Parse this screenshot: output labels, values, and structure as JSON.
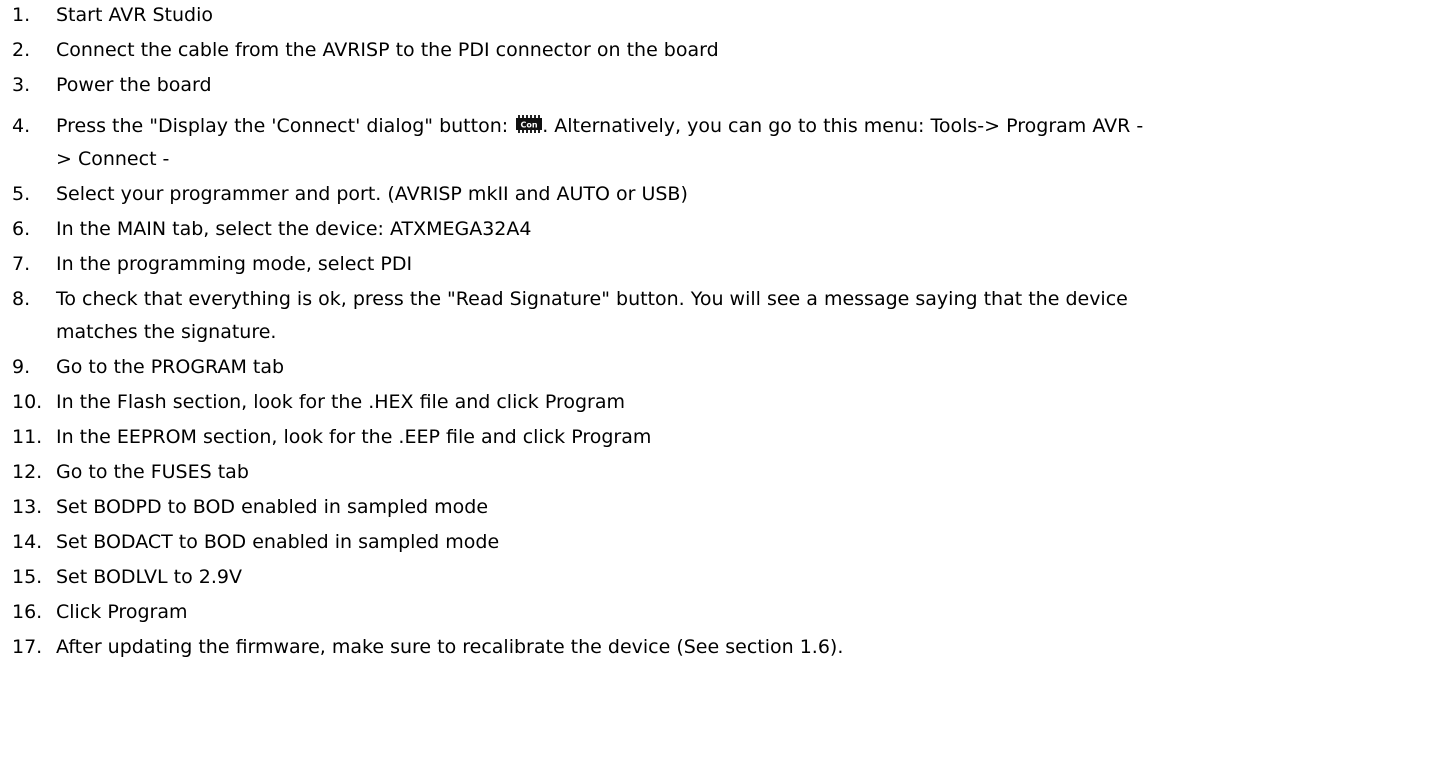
{
  "steps": [
    {
      "num": "1.",
      "text": "Start AVR Studio"
    },
    {
      "num": "2.",
      "text": "Connect the cable from the AVRISP to the PDI connector on the board"
    },
    {
      "num": "3.",
      "text": "Power the board"
    },
    {
      "num": "4.",
      "text_before": "Press the \"Display the 'Connect' dialog\" button:",
      "icon": "con-chip-icon",
      "icon_label": "Con",
      "text_after": ". Alternatively, you can go to this menu: Tools-> Program AVR -",
      "continuation": "> Connect -"
    },
    {
      "num": "5.",
      "text": "Select your programmer and port. (AVRISP mkII and AUTO or USB)"
    },
    {
      "num": "6.",
      "text": "In the MAIN tab, select the device: ATXMEGA32A4"
    },
    {
      "num": "7.",
      "text": "In the programming mode, select PDI"
    },
    {
      "num": "8.",
      "text": "To check that everything is ok, press the \"Read Signature\" button. You will see a message saying that the device",
      "continuation": "matches the signature."
    },
    {
      "num": "9.",
      "text": "Go to the PROGRAM tab"
    },
    {
      "num": "10.",
      "text": "In the Flash section, look for the .HEX file and click Program"
    },
    {
      "num": "11.",
      "text": "In the EEPROM section, look for the .EEP file and click Program"
    },
    {
      "num": "12.",
      "text": "Go to the FUSES tab"
    },
    {
      "num": "13.",
      "text": "Set BODPD to BOD enabled in sampled mode"
    },
    {
      "num": "14.",
      "text": "Set BODACT to BOD enabled in sampled mode"
    },
    {
      "num": "15.",
      "text": "Set BODLVL to 2.9V"
    },
    {
      "num": "16.",
      "text": "Click Program"
    },
    {
      "num": "17.",
      "text": "After updating the firmware, make sure to recalibrate the device (See section 1.6)."
    }
  ]
}
